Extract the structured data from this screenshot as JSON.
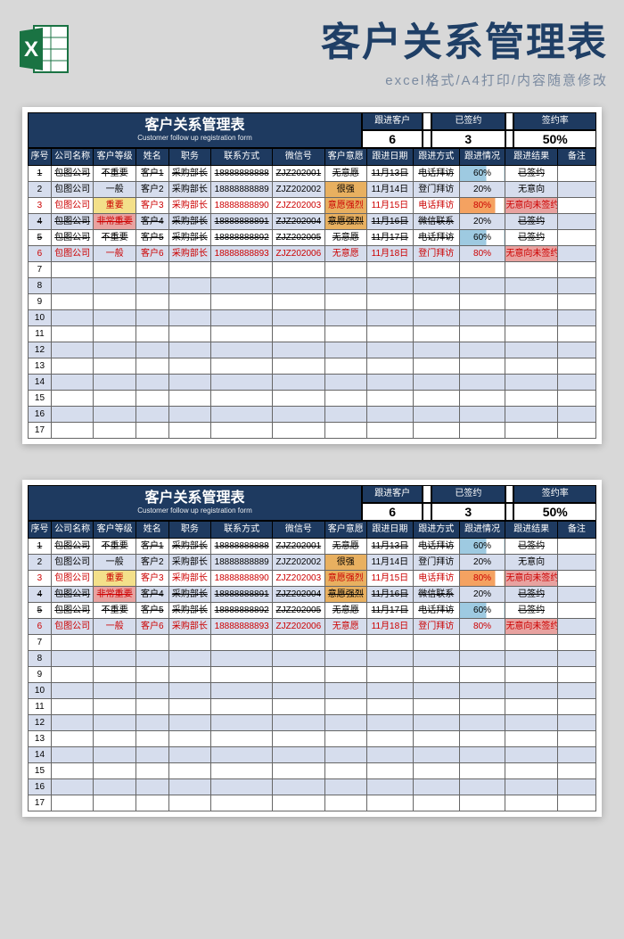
{
  "hero": {
    "title": "客户关系管理表",
    "sub": "excel格式/A4打印/内容随意修改"
  },
  "sheet": {
    "title_cn": "客户关系管理表",
    "title_en": "Customer follow up registration form",
    "stats": [
      {
        "label": "跟进客户",
        "value": "6"
      },
      {
        "label": "已签约",
        "value": "3"
      },
      {
        "label": "签约率",
        "value": "50%"
      }
    ],
    "headers": [
      "序号",
      "公司名称",
      "客户等级",
      "姓名",
      "职务",
      "联系方式",
      "微信号",
      "客户意愿",
      "跟进日期",
      "跟进方式",
      "跟进情况",
      "跟进结果",
      "备注"
    ],
    "rows": [
      {
        "n": 1,
        "strike": true,
        "company": "包图公司",
        "level": "不重要",
        "name": "客户1",
        "role": "采购部长",
        "phone": "18888888888",
        "wx": "ZJZ202001",
        "intent": "无意愿",
        "date": "11月13日",
        "way": "电话拜访",
        "prog": "60%",
        "result": "已签约"
      },
      {
        "n": 2,
        "company": "包图公司",
        "level": "一般",
        "name": "客户2",
        "role": "采购部长",
        "phone": "18888888889",
        "wx": "ZJZ202002",
        "intent": "很强",
        "intentCls": "intent-low",
        "date": "11月14日",
        "way": "登门拜访",
        "prog": "20%",
        "result": "无意向"
      },
      {
        "n": 3,
        "red": true,
        "company": "包图公司",
        "level": "重要",
        "levelCls": "lvl-imp",
        "name": "客户3",
        "role": "采购部长",
        "phone": "18888888890",
        "wx": "ZJZ202003",
        "intent": "意愿强烈",
        "intentCls": "intent-strong",
        "date": "11月15日",
        "way": "电话拜访",
        "prog": "80%",
        "result": "无意向未签约",
        "resCls": "res-no"
      },
      {
        "n": 4,
        "strike": true,
        "company": "包图公司",
        "level": "非常重要",
        "levelCls": "lvl-vimp",
        "name": "客户4",
        "role": "采购部长",
        "phone": "18888888891",
        "wx": "ZJZ202004",
        "intent": "意愿强烈",
        "intentCls": "intent-strong",
        "date": "11月16日",
        "way": "微信联系",
        "prog": "20%",
        "result": "已签约"
      },
      {
        "n": 5,
        "strike": true,
        "company": "包图公司",
        "level": "不重要",
        "name": "客户5",
        "role": "采购部长",
        "phone": "18888888892",
        "wx": "ZJZ202005",
        "intent": "无意愿",
        "date": "11月17日",
        "way": "电话拜访",
        "prog": "60%",
        "result": "已签约"
      },
      {
        "n": 6,
        "red": true,
        "company": "包图公司",
        "level": "一般",
        "name": "客户6",
        "role": "采购部长",
        "phone": "18888888893",
        "wx": "ZJZ202006",
        "intent": "无意愿",
        "date": "11月18日",
        "way": "登门拜访",
        "prog": "80%",
        "result": "无意向未签约",
        "resCls": "res-no"
      }
    ],
    "empty_rows": [
      7,
      8,
      9,
      10,
      11,
      12,
      13,
      14,
      15,
      16,
      17
    ]
  }
}
